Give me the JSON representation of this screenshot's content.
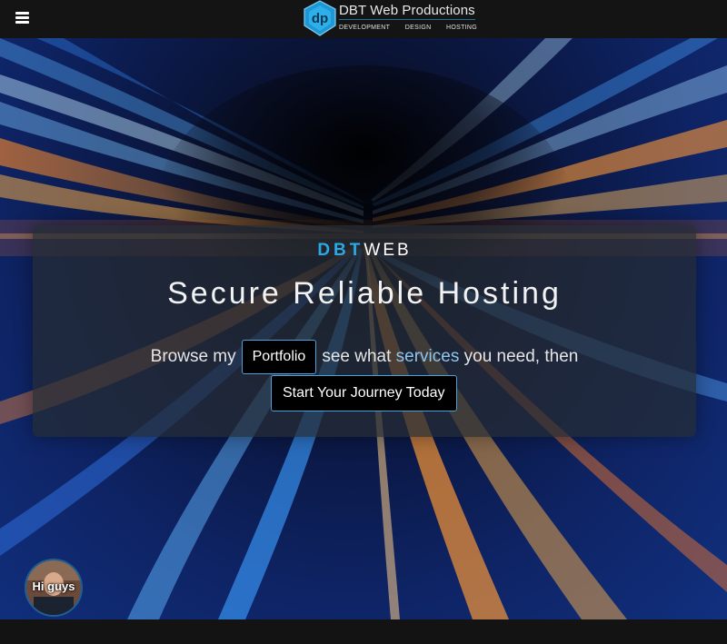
{
  "header": {
    "menu_icon": "hamburger-menu-icon",
    "brand": {
      "logo_text": "dp",
      "name": "DBT Web Productions",
      "tags": [
        "DEVELOPMENT",
        "DESIGN",
        "HOSTING"
      ]
    }
  },
  "hero": {
    "background_icon": "light-streaks-background",
    "eyebrow_accent": "DBT",
    "eyebrow_rest": "WEB",
    "headline": "Secure Reliable Hosting",
    "browse_prefix": "Browse my",
    "portfolio_button": "Portfolio",
    "browse_mid": "see what",
    "browse_services": "services",
    "browse_suffix": "you need, then",
    "journey_button": "Start Your Journey Today"
  },
  "chat_widget": {
    "caption": "Hi guys",
    "icon": "avatar-photo"
  },
  "colors": {
    "accent_blue": "#29a9e6",
    "header_bg": "#141414",
    "button_bg": "#000000"
  }
}
